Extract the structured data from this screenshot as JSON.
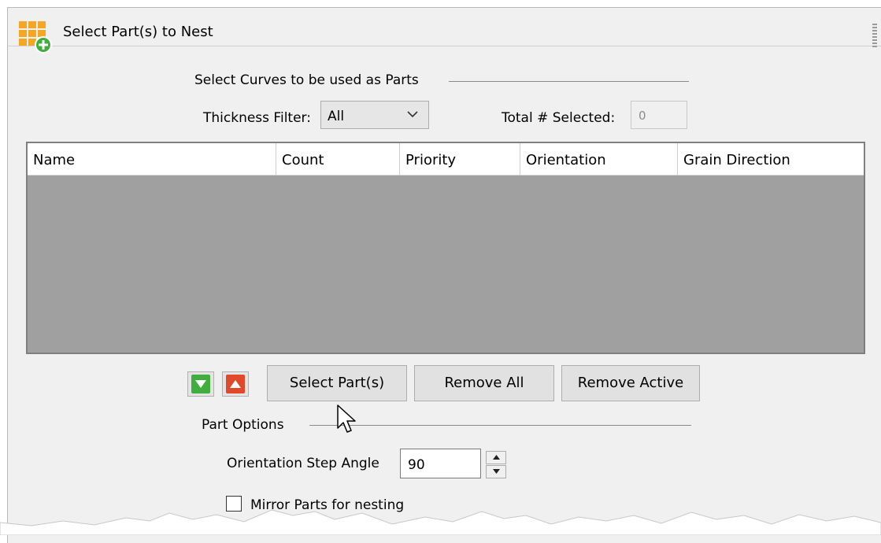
{
  "window": {
    "title": "Select Part(s) to Nest"
  },
  "curves": {
    "heading": "Select Curves to be used as Parts"
  },
  "filter": {
    "label": "Thickness Filter:",
    "value": "All"
  },
  "total": {
    "label": "Total # Selected:",
    "value": "0"
  },
  "table": {
    "columns": [
      "Name",
      "Count",
      "Priority",
      "Orientation",
      "Grain Direction"
    ],
    "rows": []
  },
  "buttons": {
    "move_down": "move-down-green-arrow",
    "move_up": "move-up-red-arrow",
    "select_parts": "Select Part(s)",
    "remove_all": "Remove All",
    "remove_active": "Remove Active"
  },
  "part_options": {
    "heading": "Part Options",
    "step_label": "Orientation Step Angle",
    "step_value": "90",
    "mirror_label": "Mirror Parts for nesting",
    "mirror_checked": false
  },
  "colors": {
    "panel_bg": "#f0f0f0",
    "grid_empty_bg": "#a0a0a0",
    "down_arrow_green": "#3fae3c",
    "up_arrow_red": "#e04a2a",
    "icon_orange": "#f5a623",
    "icon_plus_green": "#3fae3c"
  }
}
